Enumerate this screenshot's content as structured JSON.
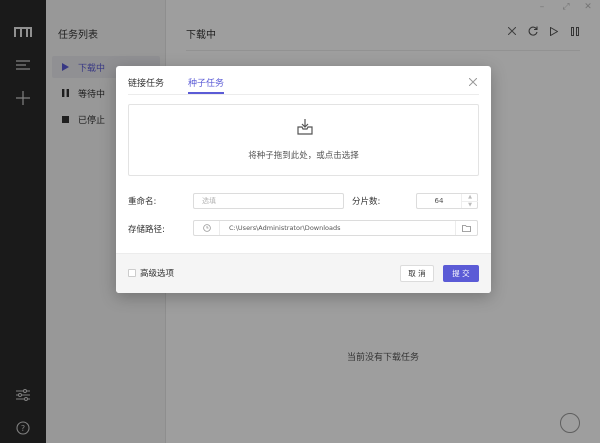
{
  "sidebar": {
    "logo_icon": "logo-icon",
    "menu_icon": "menu-icon",
    "add_icon": "plus-icon",
    "settings_icon": "sliders-icon",
    "help_icon": "help-icon"
  },
  "tasklist": {
    "title": "任务列表",
    "items": [
      {
        "label": "下载中",
        "icon": "play-icon",
        "active": true
      },
      {
        "label": "等待中",
        "icon": "pause-icon",
        "active": false
      },
      {
        "label": "已停止",
        "icon": "stop-icon",
        "active": false
      }
    ]
  },
  "main": {
    "title": "下载中",
    "empty_message": "当前没有下载任务",
    "toolbar": [
      "close-icon",
      "refresh-icon",
      "play-icon",
      "pause-icon"
    ]
  },
  "window_controls": [
    "minimize-icon",
    "maximize-icon",
    "close-icon"
  ],
  "dialog": {
    "tabs": [
      {
        "label": "链接任务",
        "active": false
      },
      {
        "label": "种子任务",
        "active": true
      }
    ],
    "dropzone_text": "将种子拖到此处，或点击选择",
    "rename_label": "重命名:",
    "rename_placeholder": "选填",
    "pieces_label": "分片数:",
    "pieces_value": "64",
    "path_label": "存储路径:",
    "path_value": "C:\\Users\\Administrator\\Downloads",
    "advanced_label": "高级选项",
    "advanced_checked": false,
    "cancel_label": "取 消",
    "submit_label": "提 交"
  },
  "colors": {
    "accent": "#5b5bd6",
    "sidebar_bg": "#2b2b2b",
    "overlay": "rgba(0,0,0,0.38)"
  }
}
